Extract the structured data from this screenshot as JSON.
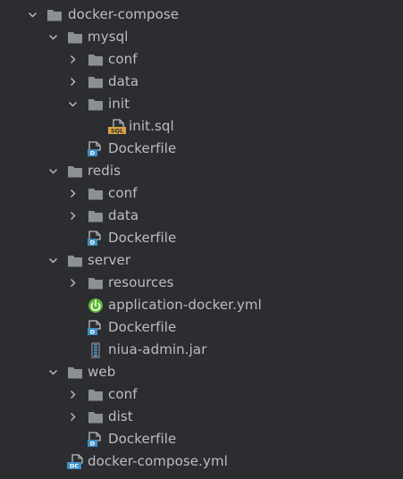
{
  "tree": {
    "root": {
      "label": "docker-compose"
    },
    "mysql": {
      "label": "mysql",
      "conf": "conf",
      "data": "data",
      "init": "init",
      "init_sql": "init.sql",
      "dockerfile": "Dockerfile"
    },
    "redis": {
      "label": "redis",
      "conf": "conf",
      "data": "data",
      "dockerfile": "Dockerfile"
    },
    "server": {
      "label": "server",
      "resources": "resources",
      "app_yml": "application-docker.yml",
      "dockerfile": "Dockerfile",
      "jar": "niua-admin.jar"
    },
    "web": {
      "label": "web",
      "conf": "conf",
      "dist": "dist",
      "dockerfile": "Dockerfile"
    },
    "compose_yml": "docker-compose.yml"
  },
  "icons": {
    "folder": "folder-icon",
    "chevron_expanded": "chevron-down-icon",
    "chevron_collapsed": "chevron-right-icon",
    "dockerfile": "dockerfile-icon",
    "sql": "sql-file-icon",
    "spring": "spring-config-icon",
    "jar": "jar-file-icon",
    "compose": "docker-compose-icon"
  },
  "colors": {
    "background": "#2b2d30",
    "text": "#bcbec4",
    "folder": "#8c9096",
    "dockerfile_blue": "#3d8fc4",
    "sql_orange": "#d9a343",
    "spring_green": "#5fb832",
    "jar_blue": "#4f8fbf"
  }
}
